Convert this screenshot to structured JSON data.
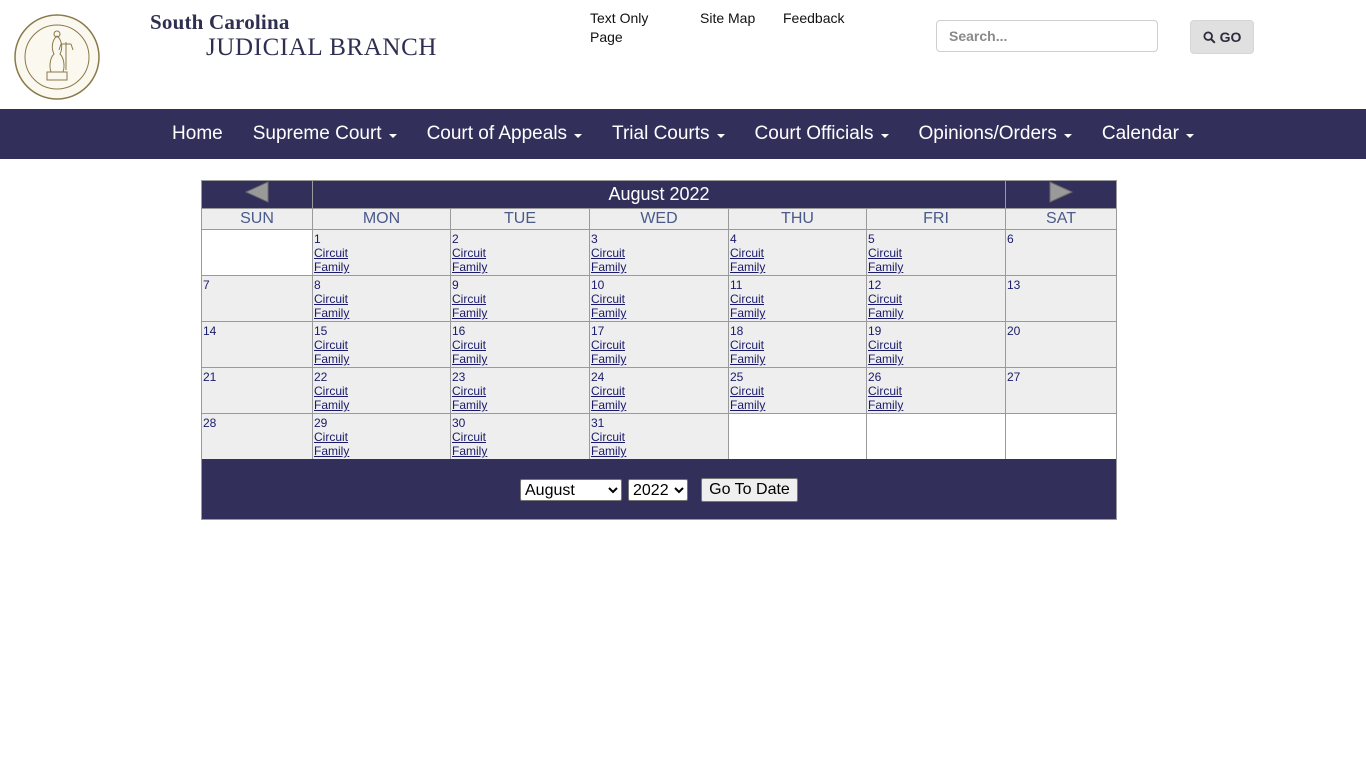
{
  "header": {
    "brand_line1": "South Carolina",
    "brand_line2": "JUDICIAL BRANCH",
    "seal_text": "SUPREME COURT OF SOUTH CAROLINA",
    "seal_motto": "NIL ULTRA",
    "links": {
      "text_only_1": "Text Only",
      "text_only_2": "Page",
      "site_map": "Site Map",
      "feedback": "Feedback"
    },
    "search_placeholder": "Search...",
    "go_label": "GO"
  },
  "nav": {
    "items": [
      {
        "label": "Home",
        "dropdown": false
      },
      {
        "label": "Supreme Court",
        "dropdown": true
      },
      {
        "label": "Court of Appeals",
        "dropdown": true
      },
      {
        "label": "Trial Courts",
        "dropdown": true
      },
      {
        "label": "Court Officials",
        "dropdown": true
      },
      {
        "label": "Opinions/Orders",
        "dropdown": true
      },
      {
        "label": "Calendar",
        "dropdown": true
      }
    ]
  },
  "calendar": {
    "title": "August 2022",
    "days_of_week": [
      "SUN",
      "MON",
      "TUE",
      "WED",
      "THU",
      "FRI",
      "SAT"
    ],
    "weeks": [
      [
        null,
        {
          "d": "1",
          "links": [
            "Circuit",
            "Family"
          ]
        },
        {
          "d": "2",
          "links": [
            "Circuit",
            "Family"
          ]
        },
        {
          "d": "3",
          "links": [
            "Circuit",
            "Family"
          ]
        },
        {
          "d": "4",
          "links": [
            "Circuit",
            "Family"
          ]
        },
        {
          "d": "5",
          "links": [
            "Circuit",
            "Family"
          ]
        },
        {
          "d": "6",
          "links": []
        }
      ],
      [
        {
          "d": "7",
          "links": []
        },
        {
          "d": "8",
          "links": [
            "Circuit",
            "Family"
          ]
        },
        {
          "d": "9",
          "links": [
            "Circuit",
            "Family"
          ]
        },
        {
          "d": "10",
          "links": [
            "Circuit",
            "Family"
          ]
        },
        {
          "d": "11",
          "links": [
            "Circuit",
            "Family"
          ]
        },
        {
          "d": "12",
          "links": [
            "Circuit",
            "Family"
          ]
        },
        {
          "d": "13",
          "links": []
        }
      ],
      [
        {
          "d": "14",
          "links": []
        },
        {
          "d": "15",
          "links": [
            "Circuit",
            "Family"
          ]
        },
        {
          "d": "16",
          "links": [
            "Circuit",
            "Family"
          ]
        },
        {
          "d": "17",
          "links": [
            "Circuit",
            "Family"
          ]
        },
        {
          "d": "18",
          "links": [
            "Circuit",
            "Family"
          ]
        },
        {
          "d": "19",
          "links": [
            "Circuit",
            "Family"
          ]
        },
        {
          "d": "20",
          "links": []
        }
      ],
      [
        {
          "d": "21",
          "links": []
        },
        {
          "d": "22",
          "links": [
            "Circuit",
            "Family"
          ]
        },
        {
          "d": "23",
          "links": [
            "Circuit",
            "Family"
          ]
        },
        {
          "d": "24",
          "links": [
            "Circuit",
            "Family"
          ]
        },
        {
          "d": "25",
          "links": [
            "Circuit",
            "Family"
          ]
        },
        {
          "d": "26",
          "links": [
            "Circuit",
            "Family"
          ]
        },
        {
          "d": "27",
          "links": []
        }
      ],
      [
        {
          "d": "28",
          "links": []
        },
        {
          "d": "29",
          "links": [
            "Circuit",
            "Family"
          ]
        },
        {
          "d": "30",
          "links": [
            "Circuit",
            "Family"
          ]
        },
        {
          "d": "31",
          "links": [
            "Circuit",
            "Family"
          ]
        },
        null,
        null,
        null
      ]
    ],
    "month_select": "August",
    "year_select": "2022",
    "go_to_date_label": "Go To Date"
  },
  "colors": {
    "navy": "#32305a",
    "cell_gray": "#eeeeee",
    "link_navy": "#1a1a6a"
  }
}
